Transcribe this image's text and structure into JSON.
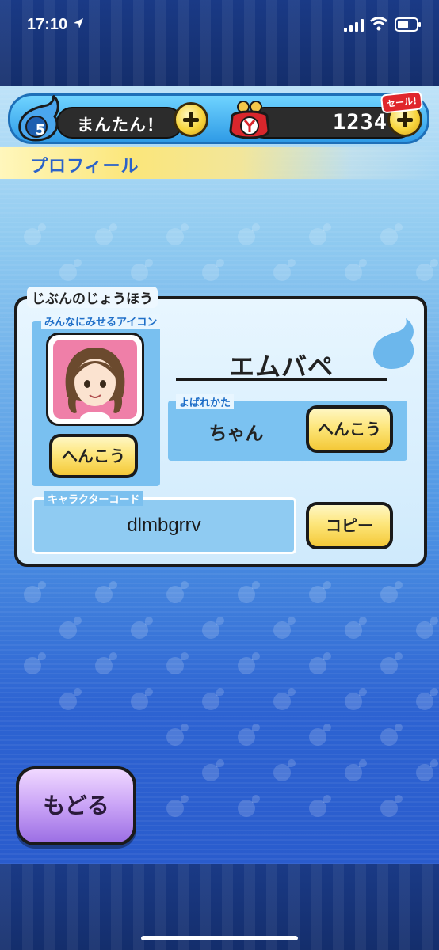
{
  "status_bar": {
    "time": "17:10"
  },
  "topbar": {
    "stamina_count": "5",
    "stamina_label": "まんたん！",
    "money": "1234",
    "sale_badge": "セール!"
  },
  "header": {
    "title": "プロフィール"
  },
  "profile": {
    "section_title": "じぶんのじょうほう",
    "icon_label": "みんなにみせるアイコン",
    "change_icon_button": "へんこう",
    "name": "エムバペ",
    "callname_label": "よばれかた",
    "callname_value": "ちゃん",
    "change_callname_button": "へんこう",
    "code_label": "キャラクターコード",
    "code_value": "dlmbgrrv",
    "copy_button": "コピー"
  },
  "footer": {
    "back_button": "もどる"
  },
  "colors": {
    "accent": "#2b62c9",
    "button_yellow": "#fde67c",
    "button_purple": "#c9a3f6"
  }
}
